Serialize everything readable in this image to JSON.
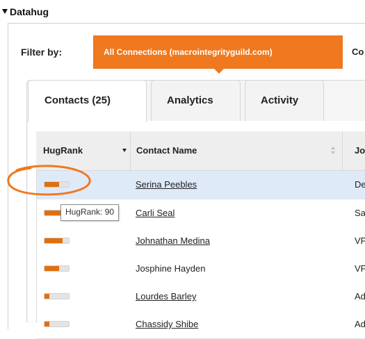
{
  "panel": {
    "title": "Datahug"
  },
  "filter": {
    "label": "Filter by:",
    "active_option": "All Connections (macrointegrityguild.com)",
    "next_option": "Co"
  },
  "tabs": [
    {
      "label": "Contacts (25)",
      "active": true
    },
    {
      "label": "Analytics",
      "active": false
    },
    {
      "label": "Activity",
      "active": false
    }
  ],
  "table": {
    "columns": [
      "HugRank",
      "Contact Name",
      "Job"
    ],
    "rows": [
      {
        "hugrank": 0.6,
        "name": "Serina Peebles",
        "job": "Dev",
        "linked": true,
        "highlighted": true
      },
      {
        "hugrank": 0.9,
        "name": "Carli Seal",
        "job": "Sale",
        "linked": true,
        "highlighted": false
      },
      {
        "hugrank": 0.75,
        "name": "Johnathan Medina",
        "job": "VP o",
        "linked": true,
        "highlighted": false
      },
      {
        "hugrank": 0.6,
        "name": "Josphine Hayden",
        "job": "VP M",
        "linked": false,
        "highlighted": false
      },
      {
        "hugrank": 0.2,
        "name": "Lourdes Barley",
        "job": "Adm",
        "linked": true,
        "highlighted": false
      },
      {
        "hugrank": 0.2,
        "name": "Chassidy Shibe",
        "job": "Adm",
        "linked": true,
        "highlighted": false
      }
    ]
  },
  "tooltip": {
    "text": "HugRank: 90"
  },
  "colors": {
    "accent": "#f0781e",
    "bar_fill": "#e0700e",
    "row_highlight": "#dfeaf9"
  }
}
